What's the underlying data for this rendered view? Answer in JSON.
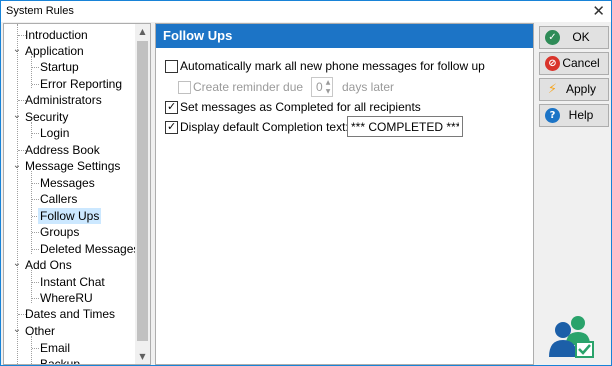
{
  "window": {
    "title": "System Rules",
    "close_glyph": "✕"
  },
  "tree": {
    "items": [
      {
        "label": "Introduction"
      },
      {
        "label": "Application"
      },
      {
        "label": "Startup"
      },
      {
        "label": "Error Reporting"
      },
      {
        "label": "Administrators"
      },
      {
        "label": "Security"
      },
      {
        "label": "Login"
      },
      {
        "label": "Address Book"
      },
      {
        "label": "Message Settings"
      },
      {
        "label": "Messages"
      },
      {
        "label": "Callers"
      },
      {
        "label": "Follow Ups"
      },
      {
        "label": "Groups"
      },
      {
        "label": "Deleted Messages"
      },
      {
        "label": "Add Ons"
      },
      {
        "label": "Instant Chat"
      },
      {
        "label": "WhereRU"
      },
      {
        "label": "Dates and Times"
      },
      {
        "label": "Other"
      },
      {
        "label": "Email"
      },
      {
        "label": "Backup"
      }
    ],
    "selected": "Follow Ups",
    "expand_glyph": "⌄",
    "scroll_up_glyph": "▲",
    "scroll_down_glyph": "▼"
  },
  "panel": {
    "title": "Follow Ups",
    "auto_mark": {
      "label": "Automatically mark all new phone messages for follow up",
      "checked": false
    },
    "reminder": {
      "prefix": "Create reminder due",
      "value": "0",
      "suffix": "days later",
      "checked": false,
      "enabled": false
    },
    "set_completed": {
      "label": "Set messages as Completed for all recipients",
      "checked": true
    },
    "display_text": {
      "label": "Display default Completion text:",
      "checked": true,
      "value": "*** COMPLETED ***"
    }
  },
  "buttons": {
    "ok": {
      "label": "OK",
      "icon": "check-icon",
      "color": "#2e8b57"
    },
    "cancel": {
      "label": "Cancel",
      "icon": "no-entry-icon",
      "color": "#d9342b"
    },
    "apply": {
      "label": "Apply",
      "icon": "lightning-icon",
      "color": "#f5a623"
    },
    "help": {
      "label": "Help",
      "icon": "question-icon",
      "color": "#1c74c6"
    }
  },
  "colors": {
    "header_blue": "#1c74c6",
    "selection": "#cce8ff"
  }
}
